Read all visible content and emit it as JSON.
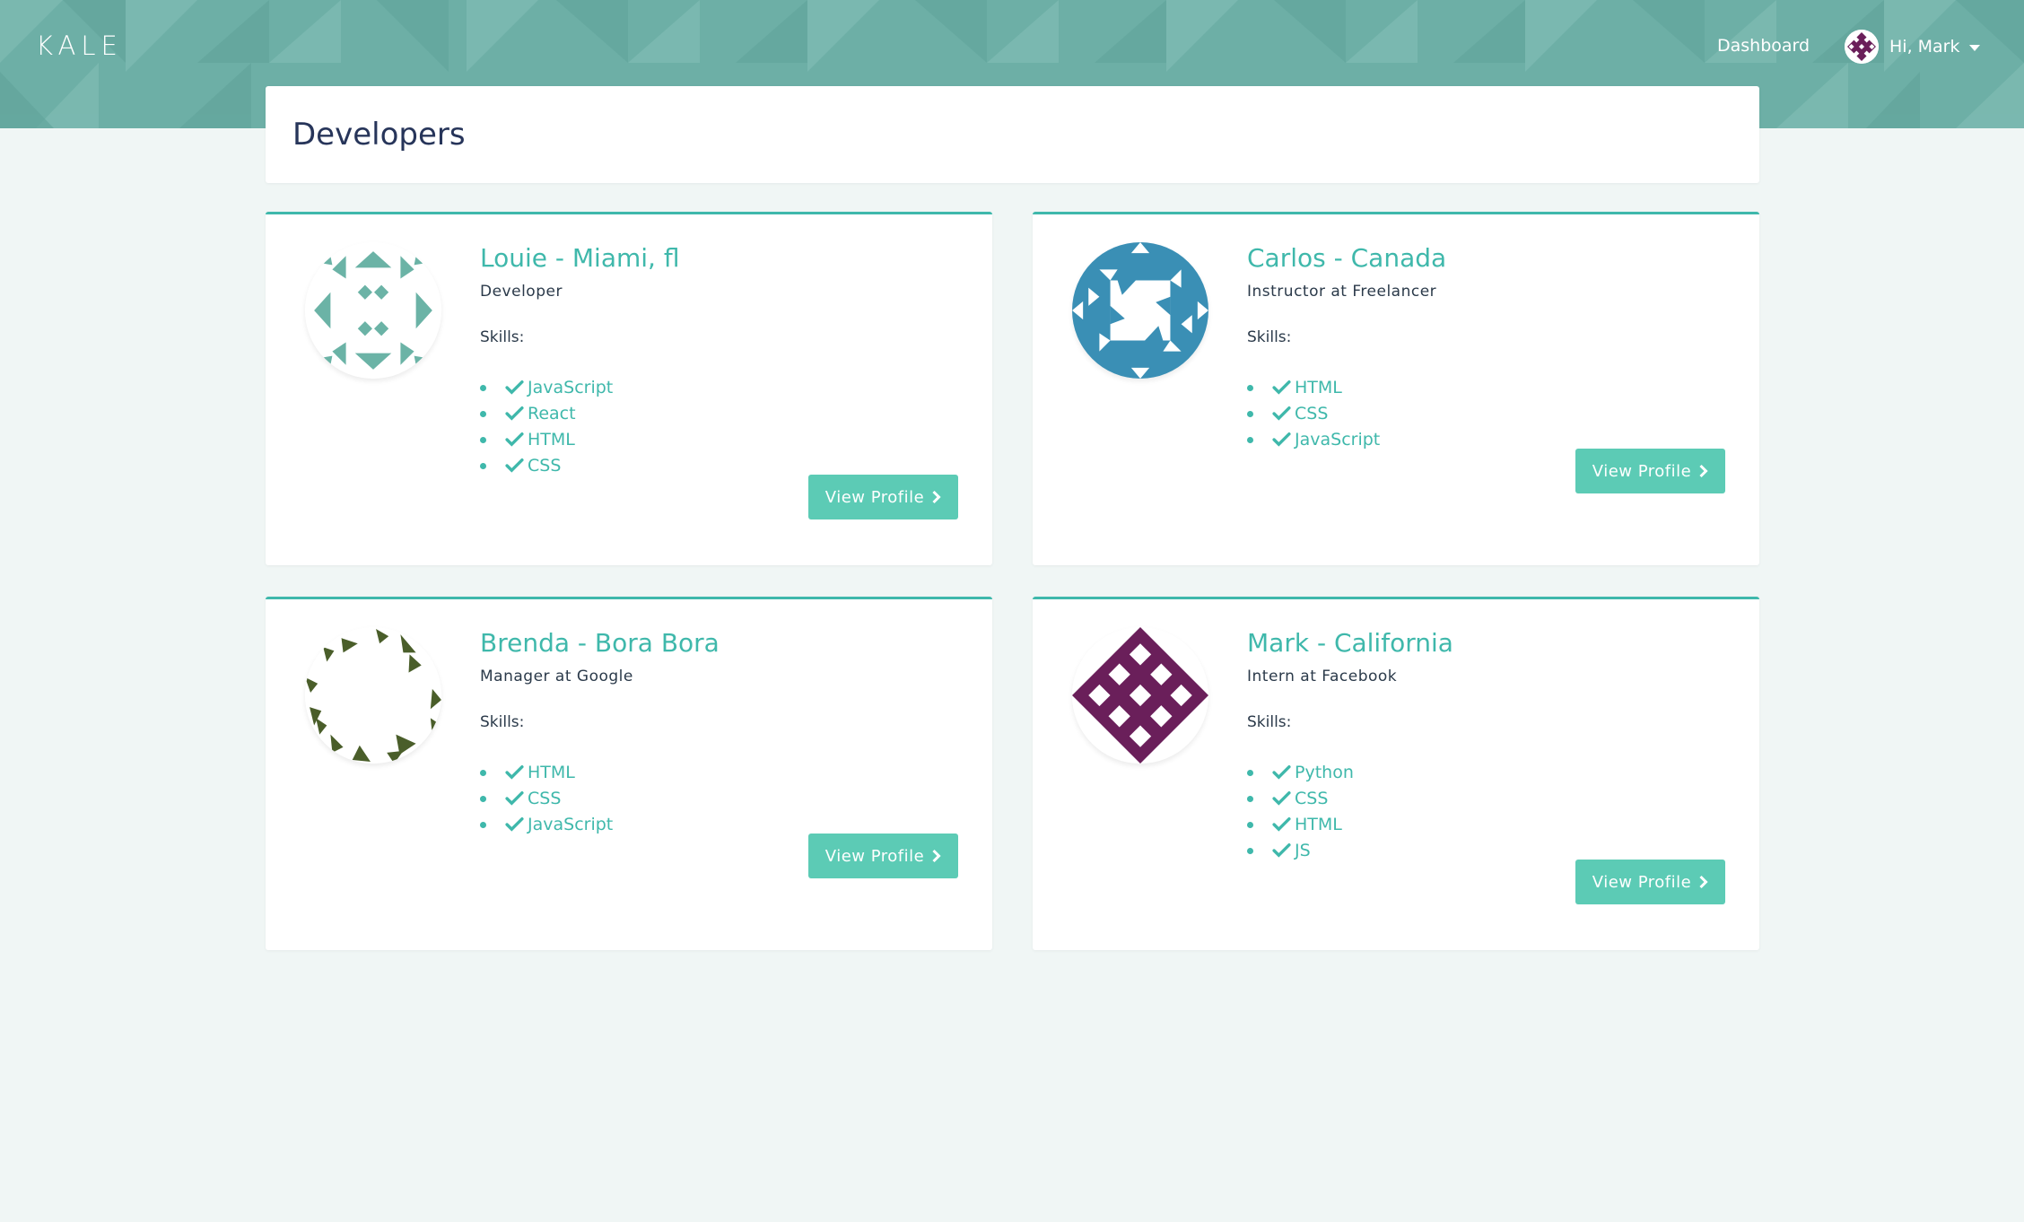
{
  "navbar": {
    "brand": "KALE",
    "dashboard_link": "Dashboard",
    "greeting": "Hi, Mark"
  },
  "page": {
    "title": "Developers"
  },
  "developers": [
    {
      "name": "Louie - Miami, fl",
      "role": "Developer",
      "skills_label": "Skills:",
      "skills": [
        "JavaScript",
        "React",
        "HTML",
        "CSS"
      ],
      "button_label": "View Profile",
      "avatar_color": "#6bb3a6"
    },
    {
      "name": "Carlos - Canada",
      "role": "Instructor at Freelancer",
      "skills_label": "Skills:",
      "skills": [
        "HTML",
        "CSS",
        "JavaScript"
      ],
      "button_label": "View Profile",
      "avatar_color": "#3a8fb5"
    },
    {
      "name": "Brenda - Bora Bora",
      "role": "Manager at Google",
      "skills_label": "Skills:",
      "skills": [
        "HTML",
        "CSS",
        "JavaScript"
      ],
      "button_label": "View Profile",
      "avatar_color": "#4a5e2a"
    },
    {
      "name": "Mark - California",
      "role": "Intern at Facebook",
      "skills_label": "Skills:",
      "skills": [
        "Python",
        "CSS",
        "HTML",
        "JS"
      ],
      "button_label": "View Profile",
      "avatar_color": "#6a1f5a"
    }
  ],
  "colors": {
    "accent": "#3fb8ab",
    "button": "#5ccbb5",
    "header": "#6dafa6",
    "background": "#f0f6f5",
    "title": "#27355a"
  },
  "icons": [
    "check-icon",
    "chevron-right-icon",
    "caret-down-icon"
  ]
}
